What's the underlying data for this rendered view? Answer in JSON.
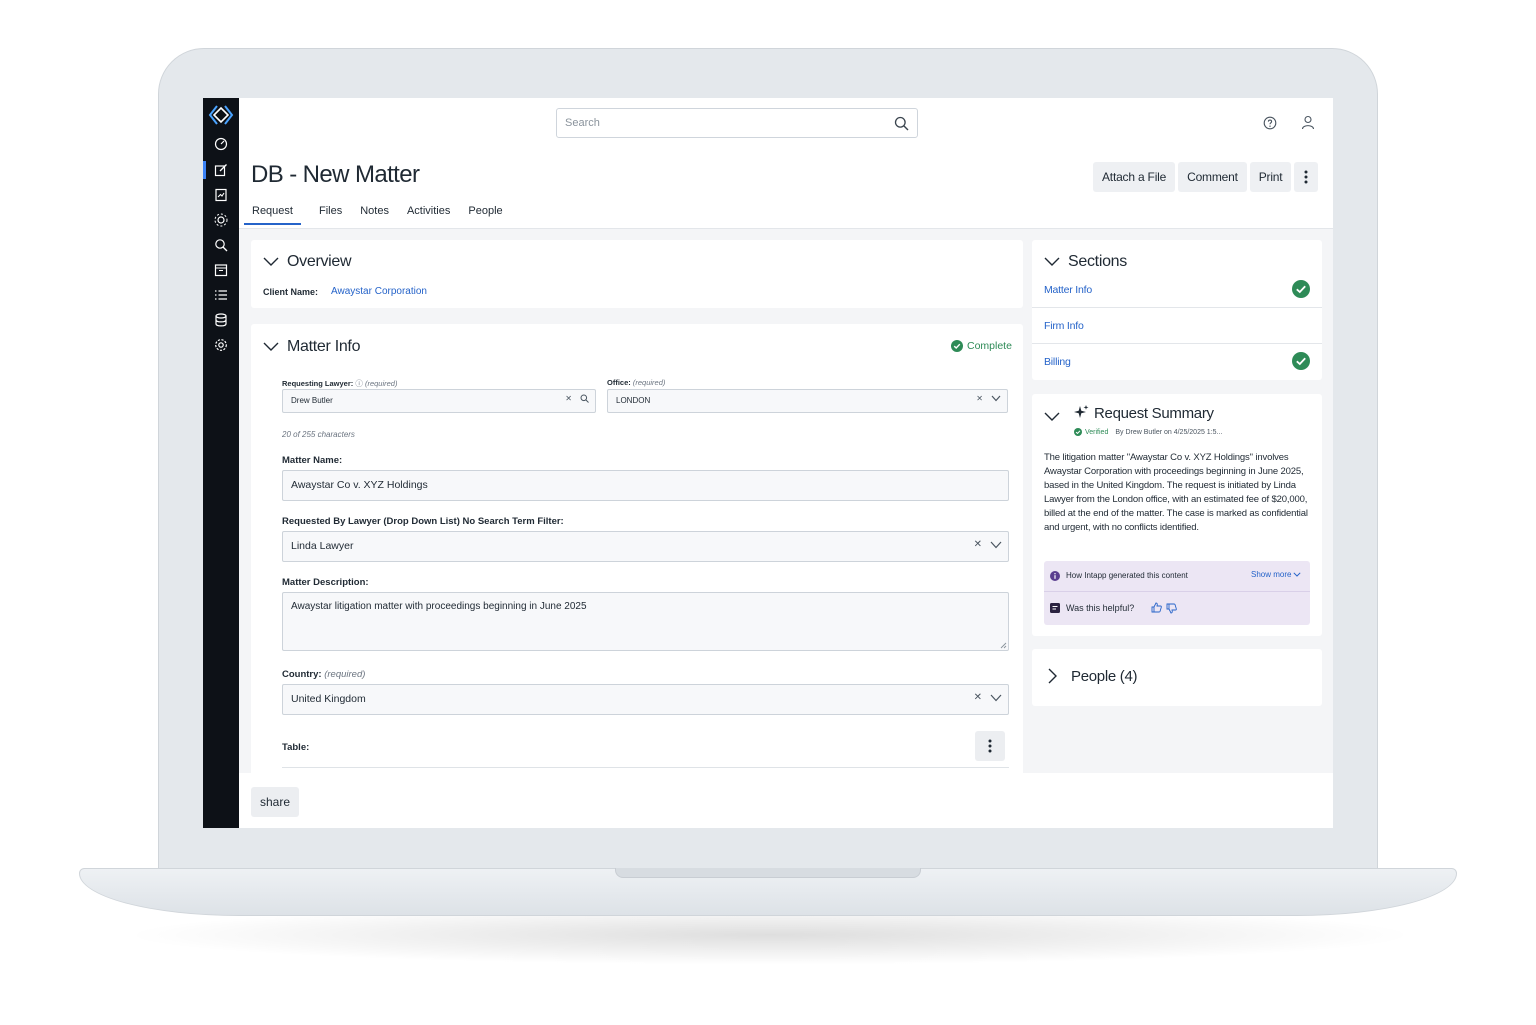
{
  "search": {
    "placeholder": "Search"
  },
  "page": {
    "title": "DB - New Matter"
  },
  "actions": {
    "attach": "Attach a File",
    "comment": "Comment",
    "print": "Print"
  },
  "tabs": [
    {
      "label": "Request"
    },
    {
      "label": "Files"
    },
    {
      "label": "Notes"
    },
    {
      "label": "Activities"
    },
    {
      "label": "People"
    }
  ],
  "overview": {
    "title": "Overview",
    "client_label": "Client Name:",
    "client_value": "Awaystar Corporation"
  },
  "matter_info": {
    "title": "Matter Info",
    "status": "Complete",
    "requesting_lawyer_label": "Requesting Lawyer:",
    "requesting_lawyer_req": "(required)",
    "requesting_lawyer_value": "Drew Butler",
    "office_label": "Office:",
    "office_req": "(required)",
    "office_value": "LONDON",
    "char_count": "20 of 255 characters",
    "matter_name_label": "Matter Name:",
    "matter_name_value": "Awaystar Co v. XYZ Holdings",
    "requested_by_label": "Requested By Lawyer (Drop Down List) No Search Term Filter:",
    "requested_by_value": "Linda Lawyer",
    "description_label": "Matter Description:",
    "description_value": "Awaystar litigation matter with proceedings beginning in June 2025",
    "country_label": "Country:",
    "country_req": "(required)",
    "country_value": "United Kingdom",
    "table_label": "Table:"
  },
  "sections": {
    "title": "Sections",
    "items": [
      {
        "label": "Matter Info",
        "complete": true
      },
      {
        "label": "Firm Info",
        "complete": false
      },
      {
        "label": "Billing",
        "complete": true
      }
    ]
  },
  "summary": {
    "title": "Request Summary",
    "verified": "Verified",
    "verified_by": "By Drew Butler on 4/25/2025 1:5...",
    "text": "The litigation matter \"Awaystar Co v. XYZ Holdings\" involves Awaystar Corporation with proceedings beginning in June 2025, based in the United Kingdom. The request is initiated by Linda Lawyer from the London office, with an estimated fee of $20,000, billed at the end of the matter. The case is marked as confidential and urgent, with no conflicts identified.",
    "how_generated": "How Intapp generated this content",
    "show_more": "Show more",
    "helpful": "Was this helpful?"
  },
  "people": {
    "title": "People (4)"
  },
  "footer": {
    "share": "share"
  },
  "colors": {
    "accent": "#2563c9",
    "success": "#2e8b57",
    "rail": "#0d1117",
    "ai_box": "#ece6f4"
  }
}
